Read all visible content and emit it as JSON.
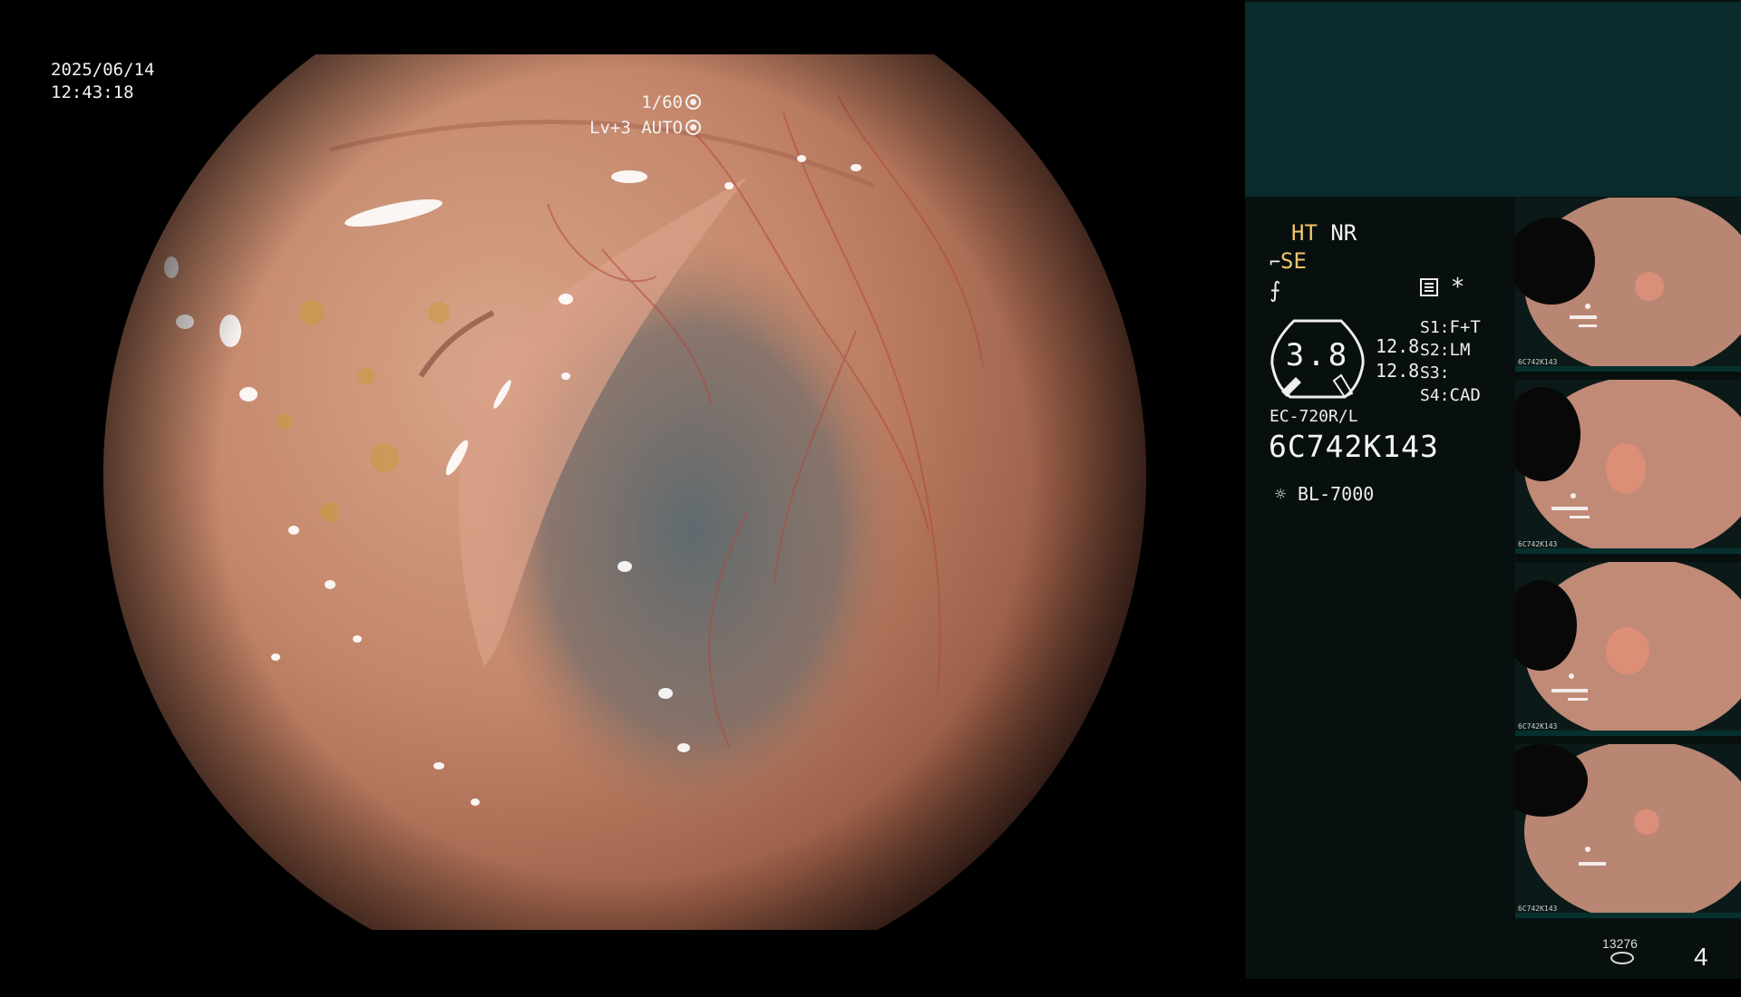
{
  "overlay": {
    "date": "2025/06/14",
    "time": "12:43:18",
    "shutter": "1/60",
    "level": "Lv+3 AUTO"
  },
  "settings": {
    "ht": "HT",
    "nr": "NR",
    "se": "SE",
    "gauge_value": "3.8",
    "readout_1": "12.8",
    "readout_2": "12.8",
    "s1_label": "S1:",
    "s1_value": "F+T",
    "s2_label": "S2:",
    "s2_value": "LM",
    "s3_label": "S3:",
    "s3_value": "",
    "s4_label": "S4:",
    "s4_value": "CAD",
    "star": "*",
    "model": "EC-720R/L",
    "serial": "6C742K143",
    "light_source": "BL-7000"
  },
  "thumbnails": [
    {
      "caption": "6C742K143",
      "lesion": "polyp"
    },
    {
      "caption": "6C742K143",
      "lesion": "polyp"
    },
    {
      "caption": "6C742K143",
      "lesion": "polyp"
    },
    {
      "caption": "6C742K143",
      "lesion": "polyp"
    }
  ],
  "footer": {
    "count": "13276",
    "page_number": "4"
  },
  "colors": {
    "accent_yellow": "#f2c46a",
    "panel_top": "#0a2b2b",
    "panel_bg": "#08100f"
  },
  "icons": [
    "shutter-icon",
    "auto-iris-icon",
    "structure-enhance-icon",
    "color-enhance-icon",
    "menu-icon",
    "light-source-icon",
    "disk-icon"
  ]
}
